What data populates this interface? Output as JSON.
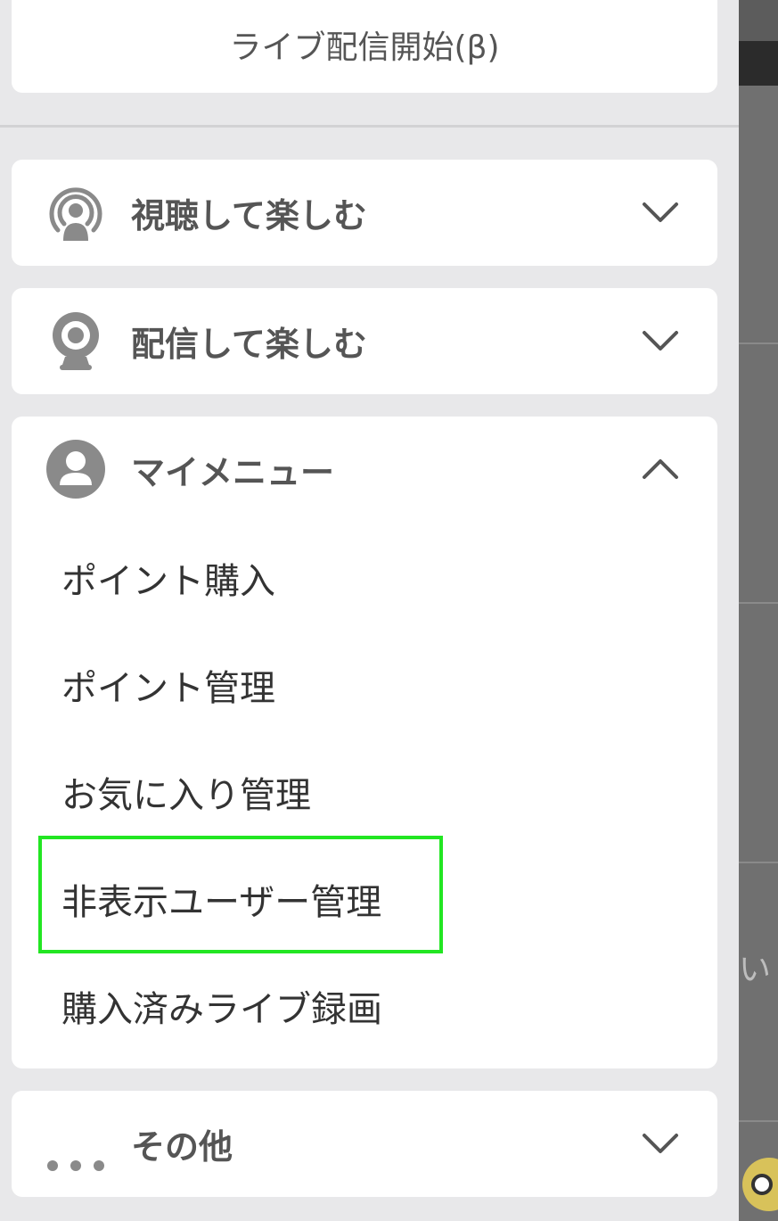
{
  "drawer": {
    "live_button_label": "ライブ配信開始(β)",
    "sections": {
      "watch": {
        "title": "視聴して楽しむ",
        "icon": "broadcast-viewer-icon",
        "expanded": false
      },
      "broadcast": {
        "title": "配信して楽しむ",
        "icon": "webcam-icon",
        "expanded": false
      },
      "mymenu": {
        "title": "マイメニュー",
        "icon": "user-avatar-icon",
        "expanded": true,
        "items": [
          {
            "label": "ポイント購入"
          },
          {
            "label": "ポイント管理"
          },
          {
            "label": "お気に入り管理"
          },
          {
            "label": "非表示ユーザー管理",
            "highlighted": true
          },
          {
            "label": "購入済みライブ録画"
          }
        ]
      },
      "other": {
        "title": "その他",
        "icon": "more-dots-icon",
        "expanded": false
      }
    }
  },
  "background": {
    "partial_text": "い"
  },
  "colors": {
    "highlight": "#22e622",
    "drawer_bg": "#e8e8ea",
    "card_bg": "#ffffff",
    "icon": "#8a8a8a"
  }
}
